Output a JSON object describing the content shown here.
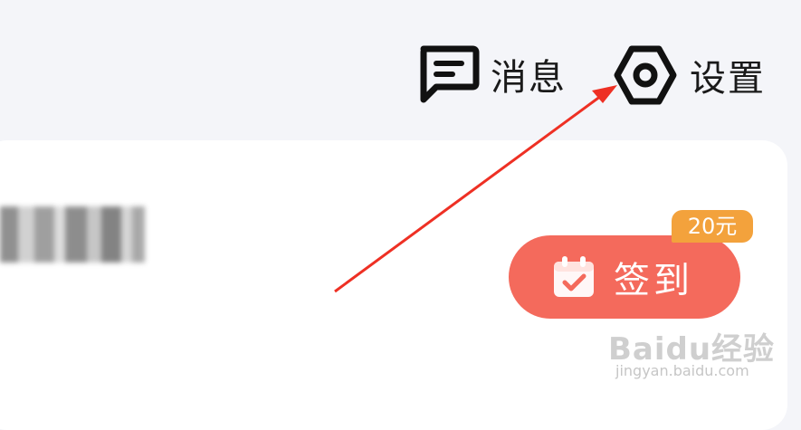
{
  "topbar": {
    "messages": {
      "label": "消息",
      "icon": "message-icon"
    },
    "settings": {
      "label": "设置",
      "icon": "gear-icon"
    }
  },
  "card": {
    "checkin": {
      "label": "签到",
      "icon": "calendar-check-icon",
      "badge": "20元"
    }
  },
  "watermark": {
    "brand": "Baidu经验",
    "url": "jingyan.baidu.com"
  },
  "colors": {
    "background": "#f4f5f9",
    "card": "#ffffff",
    "checkin_button": "#f46a5c",
    "badge": "#f3a23c",
    "annotation_arrow": "#ee3024"
  }
}
